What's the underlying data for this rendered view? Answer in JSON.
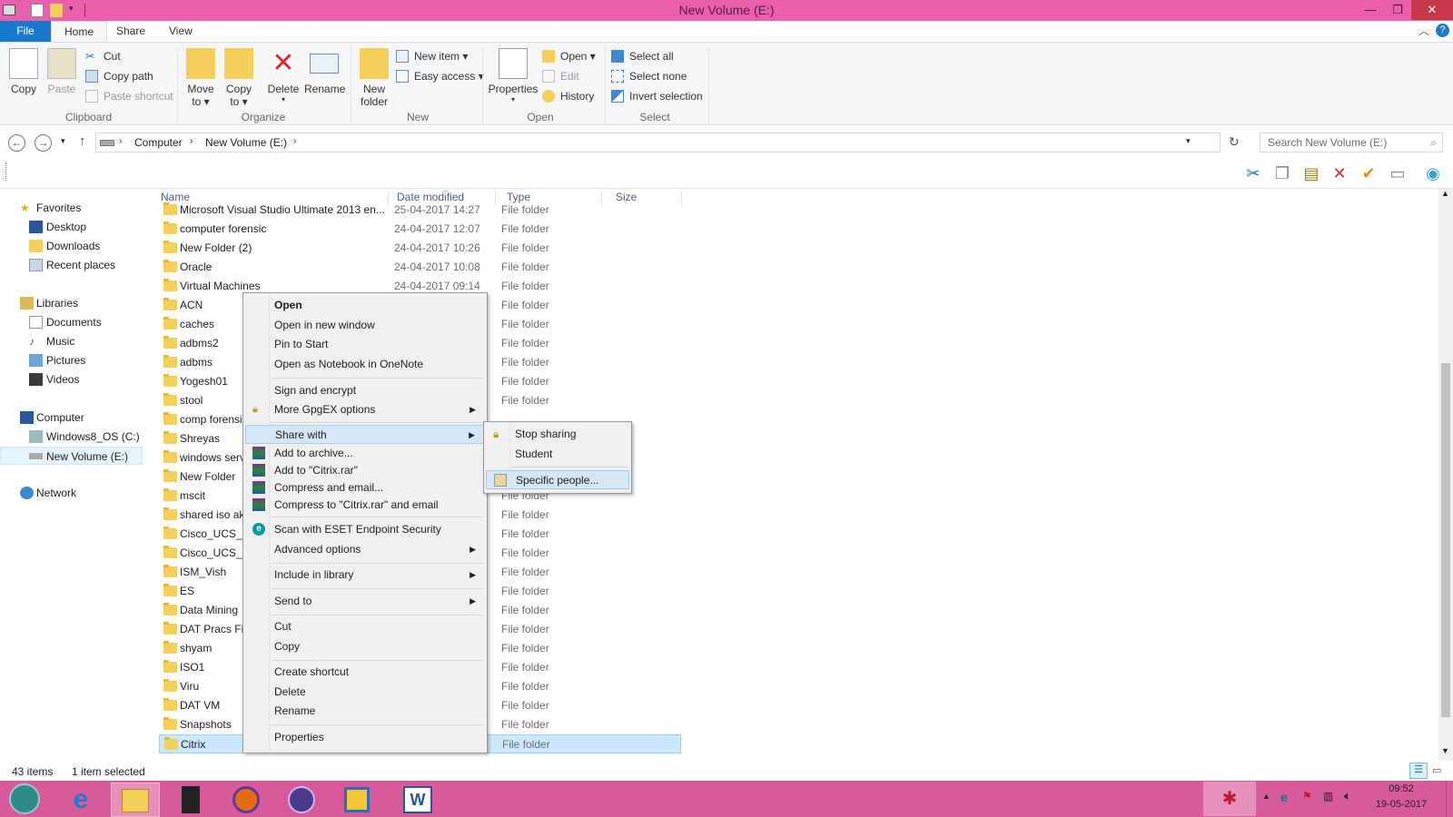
{
  "window": {
    "title": "New Volume (E:)"
  },
  "ribbon": {
    "tabs": [
      "File",
      "Home",
      "Share",
      "View"
    ],
    "clipboard": {
      "copy": "Copy",
      "paste": "Paste",
      "cut": "Cut",
      "copy_path": "Copy path",
      "paste_shortcut": "Paste shortcut",
      "label": "Clipboard"
    },
    "organize": {
      "move_to": [
        "Move",
        "to ▾"
      ],
      "copy_to": [
        "Copy",
        "to ▾"
      ],
      "delete": "Delete",
      "rename": "Rename",
      "label": "Organize"
    },
    "new": {
      "new_folder": [
        "New",
        "folder"
      ],
      "new_item": "New item ▾",
      "easy_access": "Easy access ▾",
      "label": "New"
    },
    "open": {
      "properties": "Properties",
      "open": "Open ▾",
      "edit": "Edit",
      "history": "History",
      "label": "Open"
    },
    "select": {
      "select_all": "Select all",
      "select_none": "Select none",
      "invert": "Invert selection",
      "label": "Select"
    }
  },
  "address": {
    "crumbs": [
      "Computer",
      "New Volume (E:)"
    ],
    "search_placeholder": "Search New Volume (E:)"
  },
  "nav": {
    "favorites": "Favorites",
    "desktop": "Desktop",
    "downloads": "Downloads",
    "recent": "Recent places",
    "libraries": "Libraries",
    "documents": "Documents",
    "music": "Music",
    "pictures": "Pictures",
    "videos": "Videos",
    "computer": "Computer",
    "c_drive": "Windows8_OS (C:)",
    "e_drive": "New Volume (E:)",
    "network": "Network"
  },
  "columns": [
    "Name",
    "Date modified",
    "Type",
    "Size"
  ],
  "files": [
    {
      "name": "Microsoft Visual Studio Ultimate 2013 en...",
      "date": "25-04-2017 14:27",
      "type": "File folder"
    },
    {
      "name": "computer forensic",
      "date": "24-04-2017 12:07",
      "type": "File folder"
    },
    {
      "name": "New Folder (2)",
      "date": "24-04-2017 10:26",
      "type": "File folder"
    },
    {
      "name": "Oracle",
      "date": "24-04-2017 10:08",
      "type": "File folder"
    },
    {
      "name": "Virtual Machines",
      "date": "24-04-2017 09:14",
      "type": "File folder"
    },
    {
      "name": "ACN",
      "date": "",
      "type": "File folder"
    },
    {
      "name": "caches",
      "date": "",
      "type": "File folder"
    },
    {
      "name": "adbms2",
      "date": "",
      "type": "File folder"
    },
    {
      "name": "adbms",
      "date": "",
      "type": "File folder"
    },
    {
      "name": "Yogesh01",
      "date": "",
      "type": "File folder"
    },
    {
      "name": "stool",
      "date": "",
      "type": "File folder"
    },
    {
      "name": "comp forensic",
      "date": "",
      "type": ""
    },
    {
      "name": "Shreyas",
      "date": "",
      "type": ""
    },
    {
      "name": "windows server",
      "date": "",
      "type": ""
    },
    {
      "name": "New Folder",
      "date": "",
      "type": ""
    },
    {
      "name": "mscit",
      "date": "",
      "type": "File folder"
    },
    {
      "name": "shared iso akash",
      "date": "",
      "type": "File folder"
    },
    {
      "name": "Cisco_UCS_Platform",
      "date": "",
      "type": "File folder"
    },
    {
      "name": "Cisco_UCS_Platform2",
      "date": "",
      "type": "File folder"
    },
    {
      "name": "ISM_Vish",
      "date": "",
      "type": "File folder"
    },
    {
      "name": "ES",
      "date": "",
      "type": "File folder"
    },
    {
      "name": "Data Mining",
      "date": "",
      "type": "File folder"
    },
    {
      "name": "DAT Pracs Final",
      "date": "",
      "type": "File folder"
    },
    {
      "name": "shyam",
      "date": "",
      "type": "File folder"
    },
    {
      "name": "ISO1",
      "date": "",
      "type": "File folder"
    },
    {
      "name": "Viru",
      "date": "",
      "type": "File folder"
    },
    {
      "name": "DAT VM",
      "date": "",
      "type": "File folder"
    },
    {
      "name": "Snapshots",
      "date": "",
      "type": "File folder"
    },
    {
      "name": "Citrix",
      "date": "",
      "type": "File folder"
    }
  ],
  "context_menu": {
    "open": "Open",
    "open_new_window": "Open in new window",
    "pin_start": "Pin to Start",
    "onenote": "Open as Notebook in OneNote",
    "sign_encrypt": "Sign and encrypt",
    "gpgex": "More GpgEX options",
    "share_with": "Share with",
    "add_archive": "Add to archive...",
    "add_rar": "Add to \"Citrix.rar\"",
    "compress_email": "Compress and email...",
    "compress_rar_email": "Compress to \"Citrix.rar\" and email",
    "eset": "Scan with ESET Endpoint Security",
    "advanced": "Advanced options",
    "include_library": "Include in library",
    "send_to": "Send to",
    "cut": "Cut",
    "copy": "Copy",
    "create_shortcut": "Create shortcut",
    "delete": "Delete",
    "rename": "Rename",
    "properties": "Properties"
  },
  "submenu": {
    "stop_sharing": "Stop sharing",
    "student": "Student",
    "specific_people": "Specific people..."
  },
  "status": {
    "count": "43 items",
    "selected": "1 item selected"
  },
  "clock": {
    "time": "09:52",
    "date": "19-05-2017"
  },
  "colors": {
    "titlebar": "#ea5fae",
    "taskbar": "#d75a9a",
    "file_tab": "#1979ca",
    "selection": "#cce8ff"
  }
}
